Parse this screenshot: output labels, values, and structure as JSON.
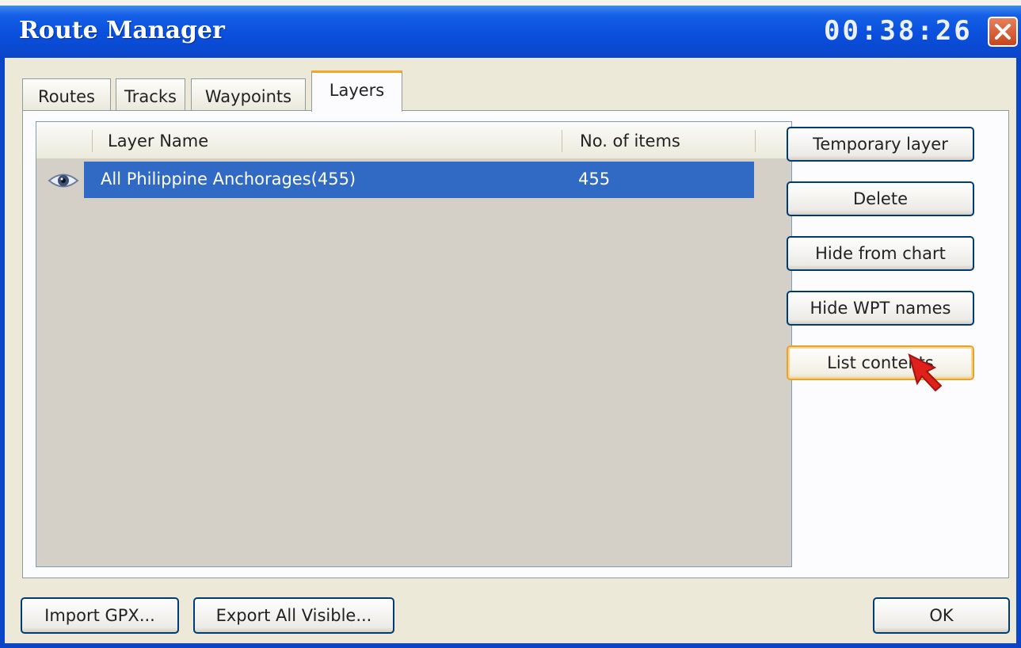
{
  "window": {
    "title": "Route Manager",
    "clock": "00:38:26"
  },
  "tabs": [
    {
      "label": "Routes",
      "active": false
    },
    {
      "label": "Tracks",
      "active": false
    },
    {
      "label": "Waypoints",
      "active": false
    },
    {
      "label": "Layers",
      "active": true
    }
  ],
  "list": {
    "columns": [
      "Layer Name",
      "No. of items"
    ],
    "rows": [
      {
        "visible_icon": "eye-icon",
        "name": "All Philippine Anchorages(455)",
        "items": "455",
        "selected": true
      }
    ]
  },
  "side_buttons": {
    "temporary_layer": "Temporary layer",
    "delete": "Delete",
    "hide_from_chart": "Hide from chart",
    "hide_wpt_names": "Hide WPT names",
    "list_contents": "List contents"
  },
  "bottom_buttons": {
    "import_gpx": "Import GPX...",
    "export_all_visible": "Export All Visible...",
    "ok": "OK"
  },
  "colors": {
    "title_bar": "#0b46c9",
    "selection": "#316ac5",
    "hover_border": "#e5a332",
    "cursor": "#e0201a"
  }
}
